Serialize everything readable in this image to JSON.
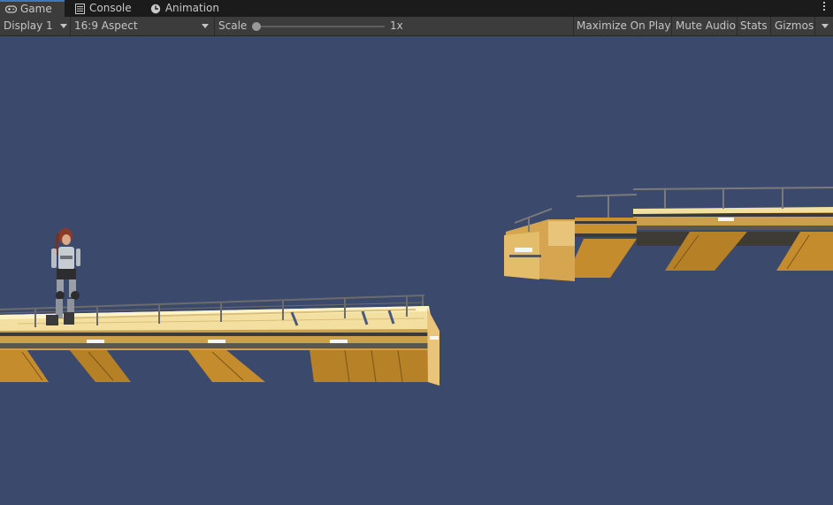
{
  "tabs": [
    {
      "label": "Game",
      "icon": "gamepad-icon",
      "active": true
    },
    {
      "label": "Console",
      "icon": "console-icon",
      "active": false
    },
    {
      "label": "Animation",
      "icon": "clock-icon",
      "active": false
    }
  ],
  "toolbar": {
    "display": "Display 1",
    "aspect": "16:9 Aspect",
    "scale_label": "Scale",
    "scale_value": "1x",
    "scale_fraction": 0.0,
    "maximize": "Maximize On Play",
    "mute": "Mute Audio",
    "stats": "Stats",
    "gizmos": "Gizmos"
  },
  "colors": {
    "viewport_bg": "#3b4a6c",
    "tab_accent": "#3a79bb",
    "toolbar_bg": "#3c3c3c",
    "platform_top": "#f3dfa0",
    "platform_side": "#c9922e"
  },
  "options_icon": "kebab-menu-icon"
}
